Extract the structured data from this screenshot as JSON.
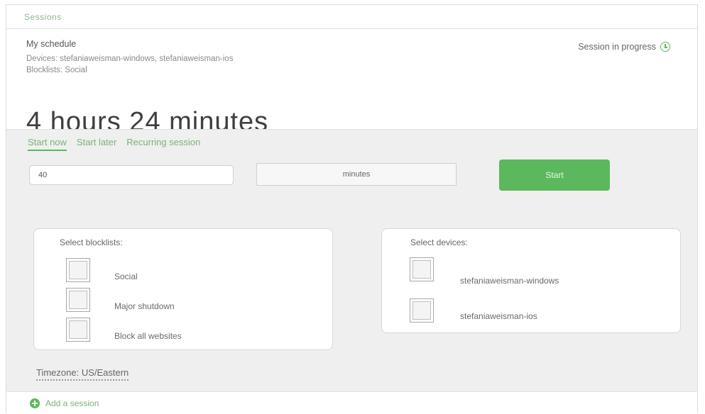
{
  "topbar": {
    "title": "Sessions"
  },
  "schedule": {
    "name": "My schedule",
    "devices": "Devices: stefaniaweisman-windows, stefaniaweisman-ios",
    "blocklists": "Blocklists: Social",
    "status": "Session in progress",
    "remaining": "4 hours 24 minutes"
  },
  "tabs": [
    {
      "label": "Start now",
      "active": true
    },
    {
      "label": "Start later",
      "active": false
    },
    {
      "label": "Recurring session",
      "active": false
    }
  ],
  "form": {
    "duration_value": "40",
    "unit": "minutes",
    "start_label": "Start"
  },
  "blocklists": {
    "title": "Select blocklists:",
    "items": [
      {
        "label": "Social",
        "checked": false
      },
      {
        "label": "Major shutdown",
        "checked": false
      },
      {
        "label": "Block all websites",
        "checked": false
      }
    ]
  },
  "devices": {
    "title": "Select devices:",
    "items": [
      {
        "label": "stefaniaweisman-windows",
        "checked": false
      },
      {
        "label": "stefaniaweisman-ios",
        "checked": false
      }
    ]
  },
  "timezone": "Timezone: US/Eastern",
  "footer": {
    "add_label": "Add a session"
  },
  "colors": {
    "accent": "#5cb85c",
    "panel_bg": "#efefef"
  },
  "icons": {
    "status": "clock-icon",
    "add": "plus-circle-icon"
  }
}
